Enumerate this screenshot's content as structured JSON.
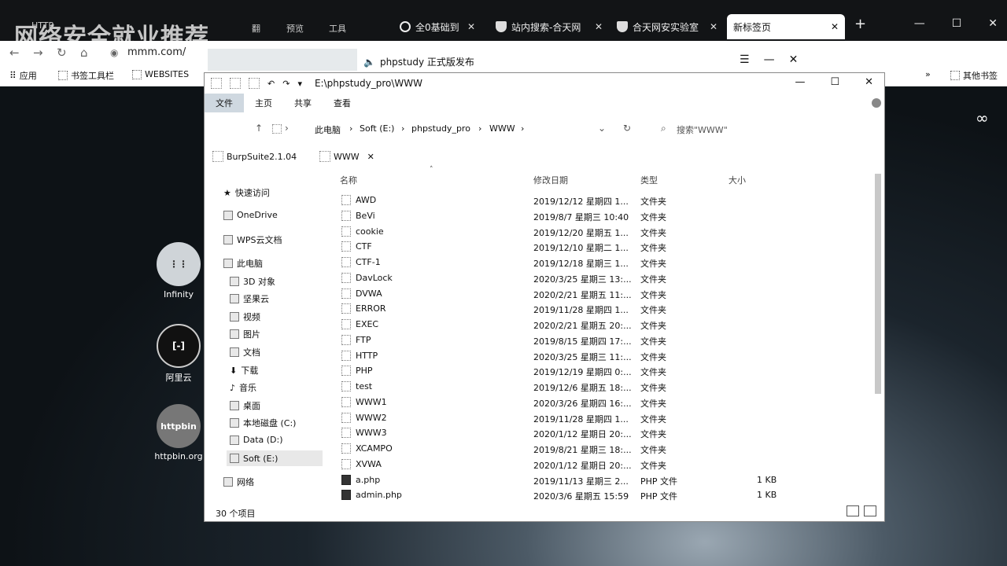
{
  "browser": {
    "watermark": "网络安全就业推荐",
    "ghost_tabs": [
      "HTTP",
      "翻",
      "预览",
      "工具"
    ],
    "tabs": [
      {
        "label": "全0基础到"
      },
      {
        "label": "站内搜索-合天网"
      },
      {
        "label": "合天网安实验室"
      },
      {
        "label": "新标签页"
      }
    ],
    "new_tab": "+",
    "url": "mmm.com/",
    "bookmarks": [
      "应用",
      "书签工具栏",
      "WEBSITES"
    ],
    "other_bookmarks": "其他书签"
  },
  "desktop": {
    "shortcuts": [
      {
        "label": "Infinity",
        "glyph": "⋮⋮"
      },
      {
        "label": "阿里云",
        "glyph": "[-]"
      },
      {
        "label": "httpbin.org",
        "glyph": "httpbin"
      }
    ],
    "infinity_symbol": "∞"
  },
  "notice": {
    "text": "phpstudy 正式版发布"
  },
  "explorer": {
    "title_path": "E:\\phpstudy_pro\\WWW",
    "ribbon_tabs": [
      "文件",
      "主页",
      "共享",
      "查看"
    ],
    "breadcrumb": [
      "此电脑",
      "Soft (E:)",
      "phpstudy_pro",
      "WWW"
    ],
    "search_placeholder": "搜索\"WWW\"",
    "quick_tabs": [
      "BurpSuite2.1.04",
      "WWW"
    ],
    "nav": [
      {
        "label": "快速访问",
        "level": 0
      },
      {
        "label": "OneDrive",
        "level": 0
      },
      {
        "label": "WPS云文档",
        "level": 0
      },
      {
        "label": "此电脑",
        "level": 0
      },
      {
        "label": "3D 对象",
        "level": 1
      },
      {
        "label": "坚果云",
        "level": 1
      },
      {
        "label": "视频",
        "level": 1
      },
      {
        "label": "图片",
        "level": 1
      },
      {
        "label": "文档",
        "level": 1
      },
      {
        "label": "下载",
        "level": 1
      },
      {
        "label": "音乐",
        "level": 1
      },
      {
        "label": "桌面",
        "level": 1
      },
      {
        "label": "本地磁盘 (C:)",
        "level": 1
      },
      {
        "label": "Data (D:)",
        "level": 1
      },
      {
        "label": "Soft (E:)",
        "level": 1
      },
      {
        "label": "网络",
        "level": 0
      }
    ],
    "columns": [
      "名称",
      "修改日期",
      "类型",
      "大小"
    ],
    "files": [
      {
        "name": "AWD",
        "date": "2019/12/12 星期四 1...",
        "type": "文件夹",
        "size": "",
        "kind": "folder"
      },
      {
        "name": "BeVi",
        "date": "2019/8/7 星期三 10:40",
        "type": "文件夹",
        "size": "",
        "kind": "folder"
      },
      {
        "name": "cookie",
        "date": "2019/12/20 星期五 1...",
        "type": "文件夹",
        "size": "",
        "kind": "folder"
      },
      {
        "name": "CTF",
        "date": "2019/12/10 星期二 1...",
        "type": "文件夹",
        "size": "",
        "kind": "folder"
      },
      {
        "name": "CTF-1",
        "date": "2019/12/18 星期三 1...",
        "type": "文件夹",
        "size": "",
        "kind": "folder"
      },
      {
        "name": "DavLock",
        "date": "2020/3/25 星期三 13:...",
        "type": "文件夹",
        "size": "",
        "kind": "folder"
      },
      {
        "name": "DVWA",
        "date": "2020/2/21 星期五 11:...",
        "type": "文件夹",
        "size": "",
        "kind": "folder"
      },
      {
        "name": "ERROR",
        "date": "2019/11/28 星期四 1...",
        "type": "文件夹",
        "size": "",
        "kind": "folder"
      },
      {
        "name": "EXEC",
        "date": "2020/2/21 星期五 20:...",
        "type": "文件夹",
        "size": "",
        "kind": "folder"
      },
      {
        "name": "FTP",
        "date": "2019/8/15 星期四 17:...",
        "type": "文件夹",
        "size": "",
        "kind": "folder"
      },
      {
        "name": "HTTP",
        "date": "2020/3/25 星期三 11:...",
        "type": "文件夹",
        "size": "",
        "kind": "folder"
      },
      {
        "name": "PHP",
        "date": "2019/12/19 星期四 0:...",
        "type": "文件夹",
        "size": "",
        "kind": "folder"
      },
      {
        "name": "test",
        "date": "2019/12/6 星期五 18:...",
        "type": "文件夹",
        "size": "",
        "kind": "folder"
      },
      {
        "name": "WWW1",
        "date": "2020/3/26 星期四 16:...",
        "type": "文件夹",
        "size": "",
        "kind": "folder"
      },
      {
        "name": "WWW2",
        "date": "2019/11/28 星期四 1...",
        "type": "文件夹",
        "size": "",
        "kind": "folder"
      },
      {
        "name": "WWW3",
        "date": "2020/1/12 星期日 20:...",
        "type": "文件夹",
        "size": "",
        "kind": "folder"
      },
      {
        "name": "XCAMPO",
        "date": "2019/8/21 星期三 18:...",
        "type": "文件夹",
        "size": "",
        "kind": "folder"
      },
      {
        "name": "XVWA",
        "date": "2020/1/12 星期日 20:...",
        "type": "文件夹",
        "size": "",
        "kind": "folder"
      },
      {
        "name": "a.php",
        "date": "2019/11/13 星期三 2...",
        "type": "PHP 文件",
        "size": "1 KB",
        "kind": "php"
      },
      {
        "name": "admin.php",
        "date": "2020/3/6 星期五 15:59",
        "type": "PHP 文件",
        "size": "1 KB",
        "kind": "php"
      }
    ],
    "item_count": "30 个项目"
  }
}
